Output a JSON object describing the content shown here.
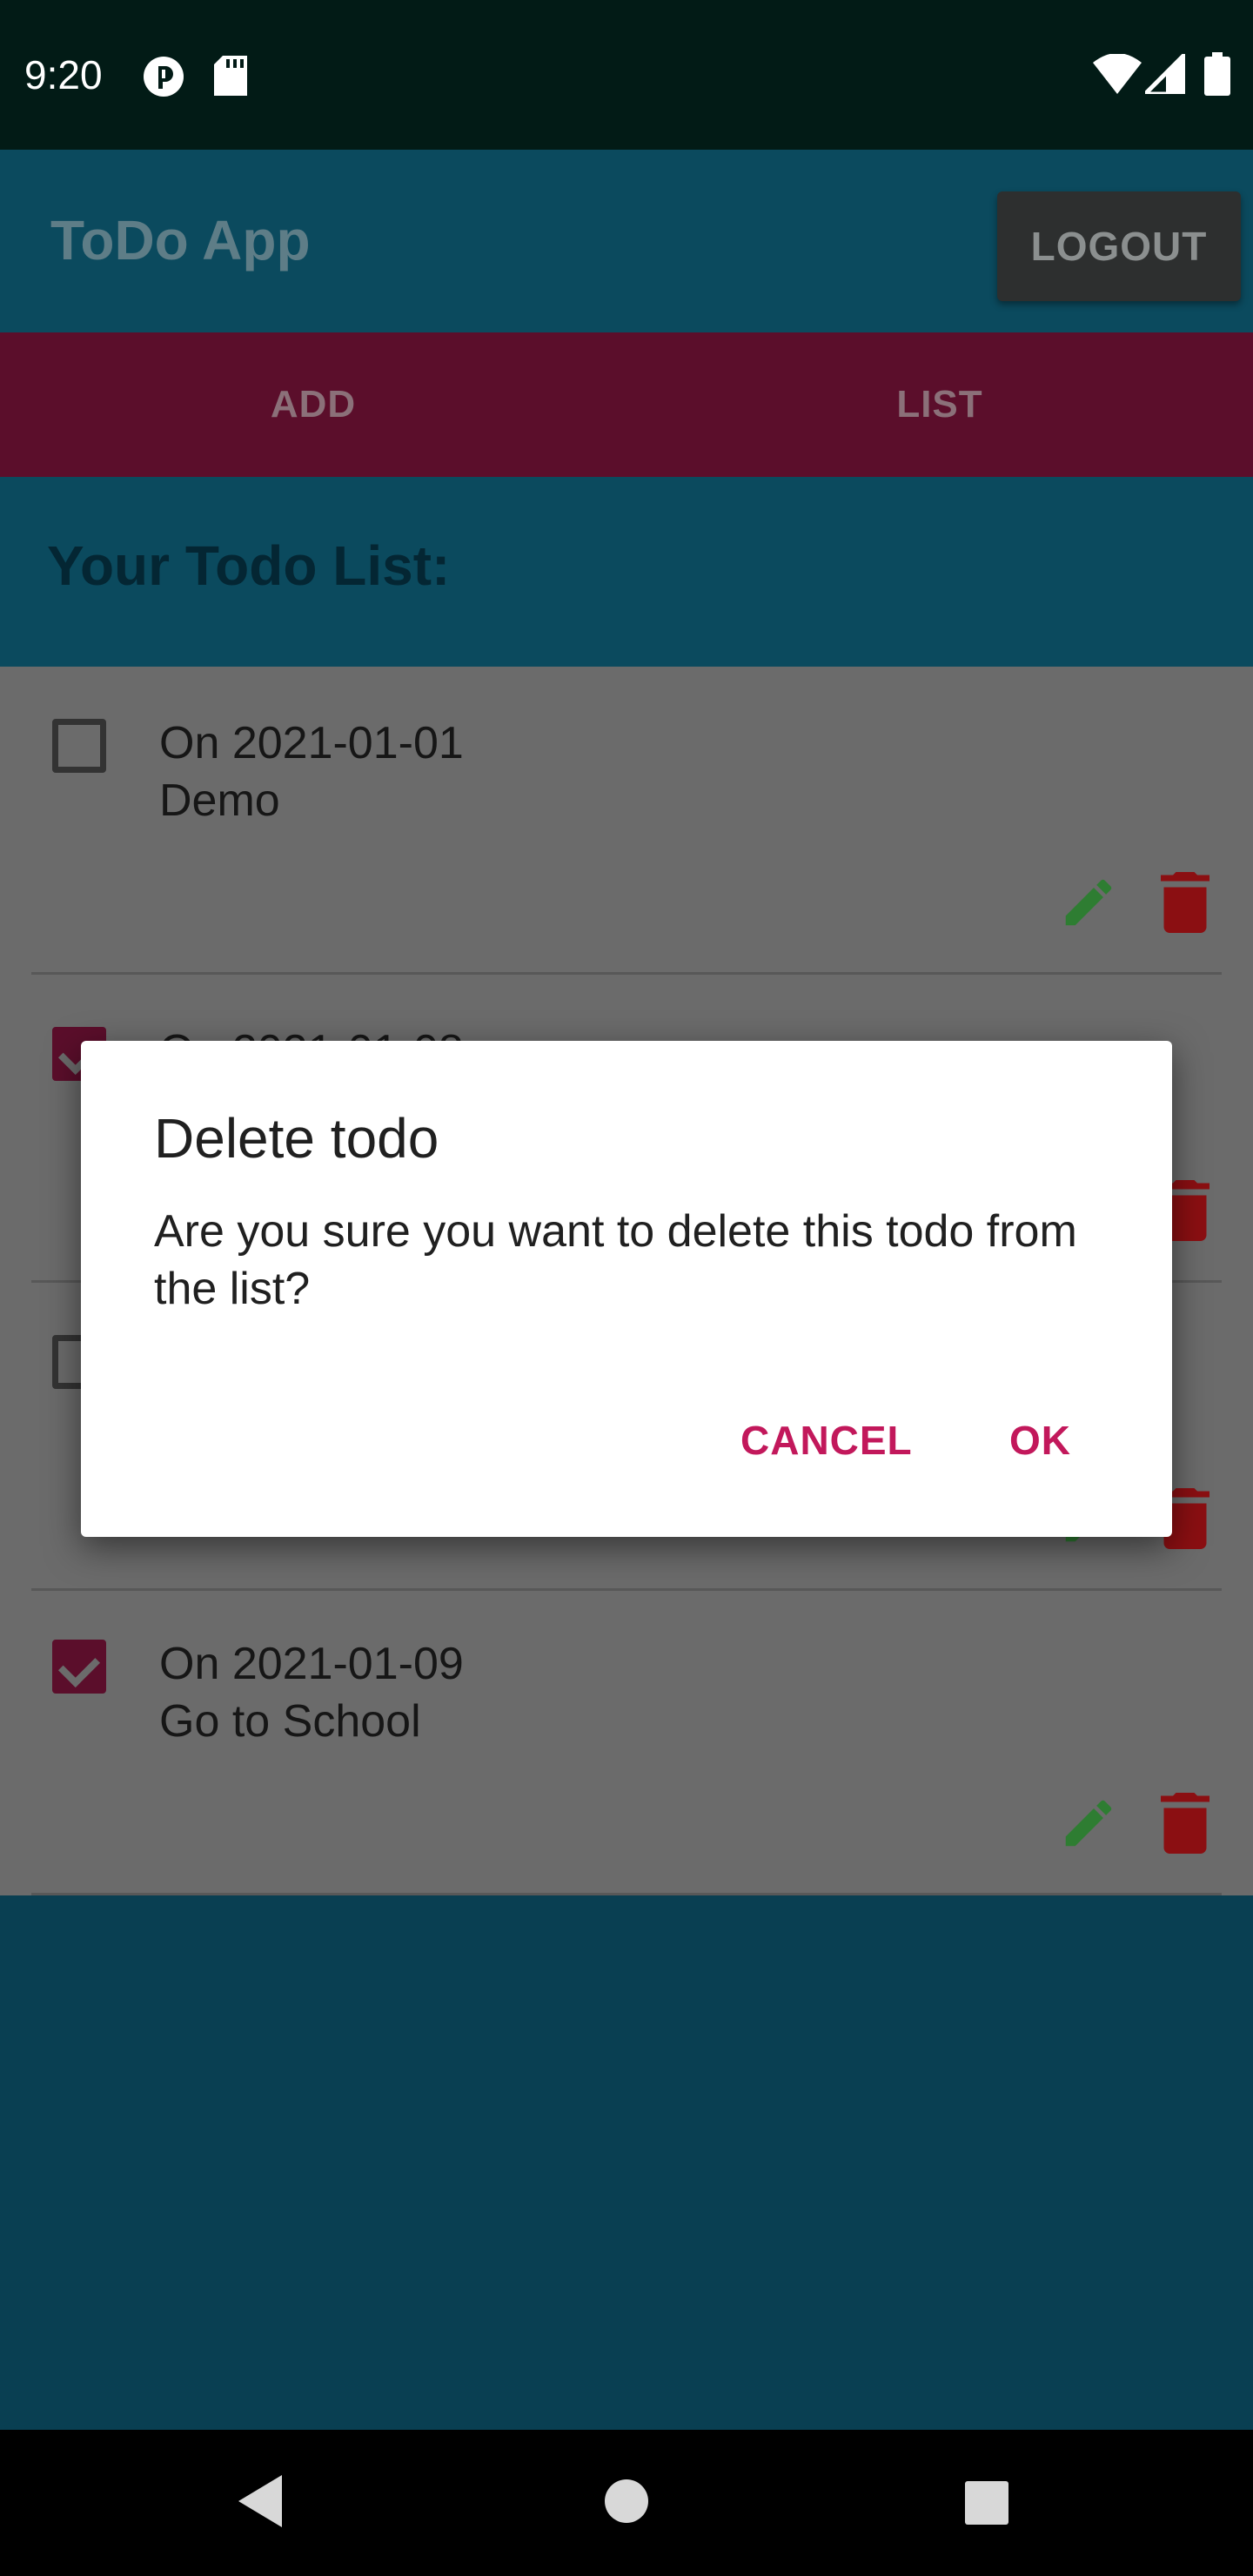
{
  "status_bar": {
    "time": "9:20",
    "icons": [
      "p-badge-icon",
      "sd-card-icon",
      "wifi-icon",
      "signal-icon",
      "battery-icon"
    ]
  },
  "app_bar": {
    "title": "ToDo App",
    "logout_label": "LOGOUT"
  },
  "tabs": [
    {
      "label": "ADD"
    },
    {
      "label": "LIST"
    }
  ],
  "list": {
    "heading": "Your Todo List:",
    "items": [
      {
        "date": "On 2021-01-01",
        "text": "Demo",
        "checked": false
      },
      {
        "date": "On 2021-01-08",
        "text": "",
        "checked": true
      },
      {
        "date": "",
        "text": "",
        "checked": false
      },
      {
        "date": "On 2021-01-09",
        "text": "Go to School",
        "checked": true
      }
    ]
  },
  "dialog": {
    "title": "Delete todo",
    "message": "Are you sure you want to delete this todo from the list?",
    "cancel_label": "CANCEL",
    "ok_label": "OK"
  },
  "colors": {
    "accent": "#c2185b",
    "edit_icon": "#2e7d32",
    "delete_icon": "#8b0f12"
  },
  "nav_bar": {
    "buttons": [
      "back-icon",
      "home-icon",
      "recents-icon"
    ]
  }
}
